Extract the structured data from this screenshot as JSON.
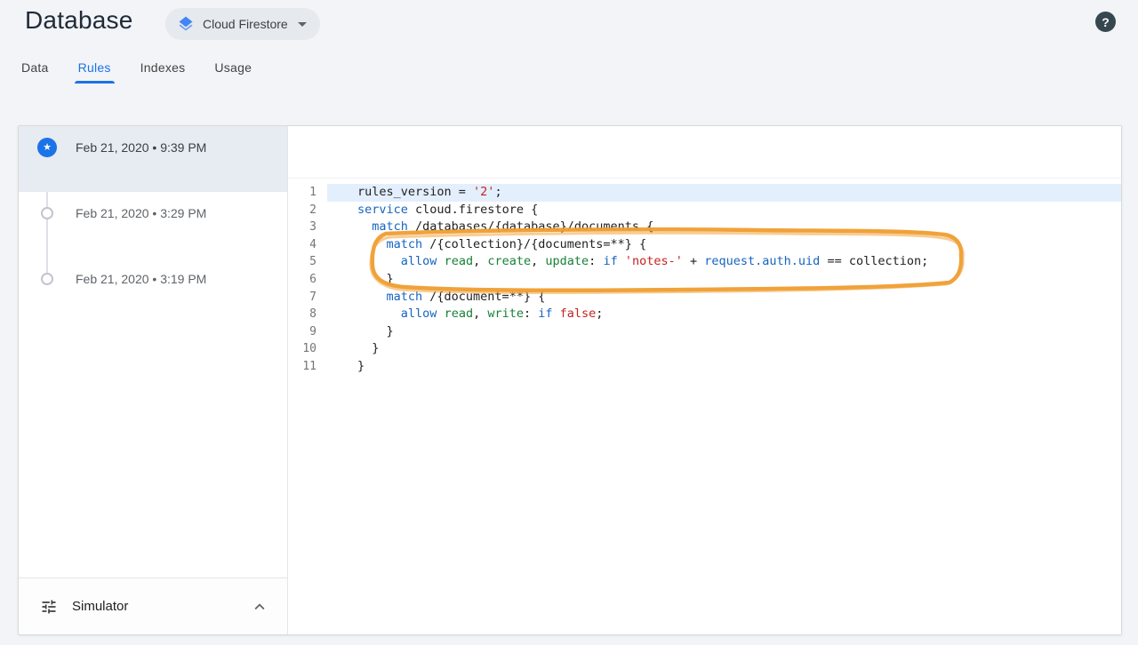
{
  "colors": {
    "accent_blue": "#1a73e8",
    "annotation_orange": "#f29a2e",
    "selected_version_bg": "#e7ebf2",
    "active_line_bg": "#e4effd",
    "syntax": {
      "keyword": "#1565c0",
      "method_green": "#188038",
      "string_red": "#c5221f",
      "plain": "#212121",
      "line_number": "#757575"
    }
  },
  "header": {
    "title": "Database",
    "product_selector": {
      "label": "Cloud Firestore",
      "icon": "firestore-layers-icon"
    },
    "help": "?"
  },
  "tabs": [
    {
      "label": "Data",
      "active": false
    },
    {
      "label": "Rules",
      "active": true
    },
    {
      "label": "Indexes",
      "active": false
    },
    {
      "label": "Usage",
      "active": false
    }
  ],
  "sidebar": {
    "versions": [
      {
        "label": "Feb 21, 2020 • 9:39 PM",
        "selected": true
      },
      {
        "label": "Feb 21, 2020 • 3:29 PM",
        "selected": false
      },
      {
        "label": "Feb 21, 2020 • 3:19 PM",
        "selected": false
      }
    ],
    "simulator": {
      "label": "Simulator"
    }
  },
  "editor": {
    "annotation": {
      "type": "hand-drawn-box",
      "color": "#f29a2e",
      "around_lines": "4-6"
    },
    "lines": [
      {
        "n": "1",
        "hl": true,
        "seg": [
          [
            "p",
            "rules_version = "
          ],
          [
            "s",
            "'2'"
          ],
          [
            "p",
            ";"
          ]
        ]
      },
      {
        "n": "2",
        "seg": [
          [
            "k",
            "service"
          ],
          [
            "p",
            " cloud.firestore {"
          ]
        ]
      },
      {
        "n": "3",
        "seg": [
          [
            "p",
            "  "
          ],
          [
            "k",
            "match"
          ],
          [
            "p",
            " /databases/{database}/documents {"
          ]
        ]
      },
      {
        "n": "4",
        "seg": [
          [
            "p",
            "    "
          ],
          [
            "k",
            "match"
          ],
          [
            "p",
            " /{collection}/{documents=**} {"
          ]
        ]
      },
      {
        "n": "5",
        "seg": [
          [
            "p",
            "      "
          ],
          [
            "k",
            "allow"
          ],
          [
            "p",
            " "
          ],
          [
            "g",
            "read"
          ],
          [
            "p",
            ", "
          ],
          [
            "g",
            "create"
          ],
          [
            "p",
            ", "
          ],
          [
            "g",
            "update"
          ],
          [
            "p",
            ": "
          ],
          [
            "k",
            "if"
          ],
          [
            "p",
            " "
          ],
          [
            "s",
            "'notes-'"
          ],
          [
            "p",
            " + "
          ],
          [
            "k",
            "request.auth.uid"
          ],
          [
            "p",
            " == collection;"
          ]
        ]
      },
      {
        "n": "6",
        "seg": [
          [
            "p",
            "    }"
          ]
        ]
      },
      {
        "n": "7",
        "seg": [
          [
            "p",
            "    "
          ],
          [
            "k",
            "match"
          ],
          [
            "p",
            " /{document=**} {"
          ]
        ]
      },
      {
        "n": "8",
        "seg": [
          [
            "p",
            "      "
          ],
          [
            "k",
            "allow"
          ],
          [
            "p",
            " "
          ],
          [
            "g",
            "read"
          ],
          [
            "p",
            ", "
          ],
          [
            "g",
            "write"
          ],
          [
            "p",
            ": "
          ],
          [
            "k",
            "if"
          ],
          [
            "p",
            " "
          ],
          [
            "s",
            "false"
          ],
          [
            "p",
            ";"
          ]
        ]
      },
      {
        "n": "9",
        "seg": [
          [
            "p",
            "    }"
          ]
        ]
      },
      {
        "n": "10",
        "seg": [
          [
            "p",
            "  }"
          ]
        ]
      },
      {
        "n": "11",
        "seg": [
          [
            "p",
            "}"
          ]
        ]
      }
    ]
  }
}
